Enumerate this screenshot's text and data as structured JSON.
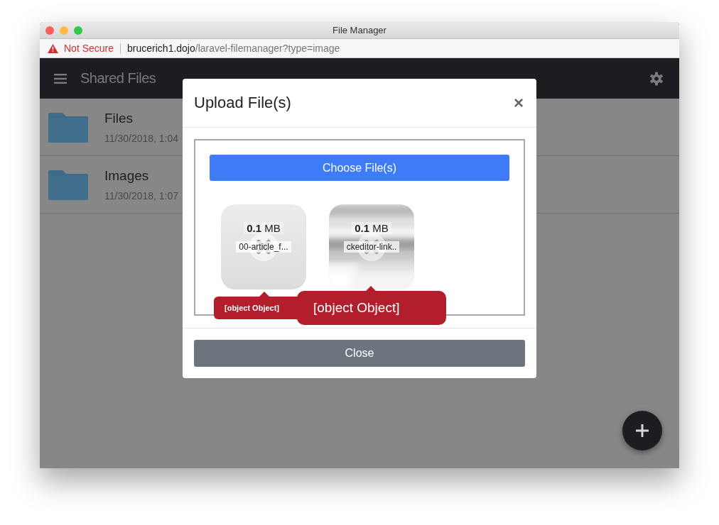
{
  "window": {
    "title": "File Manager"
  },
  "address_bar": {
    "warning": "Not Secure",
    "host": "brucerich1.dojo",
    "path": "/laravel-filemanager?type=image"
  },
  "navbar": {
    "title": "Shared Files"
  },
  "folders": [
    {
      "name": "Files",
      "date": "11/30/2018, 1:04"
    },
    {
      "name": "Images",
      "date": "11/30/2018, 1:07"
    }
  ],
  "modal": {
    "title": "Upload File(s)",
    "close": "×",
    "choose_button": "Choose File(s)",
    "previews": [
      {
        "kind": "plain",
        "size": "**0.1** MB",
        "name": "00-article_f..."
      },
      {
        "kind": "picture",
        "size": "**0.1** MB",
        "name": "ckeditor-link.."
      }
    ],
    "tooltips": [
      {
        "text": "[object Object]"
      },
      {
        "text": "[object Object]"
      }
    ],
    "close_button": "Close"
  }
}
